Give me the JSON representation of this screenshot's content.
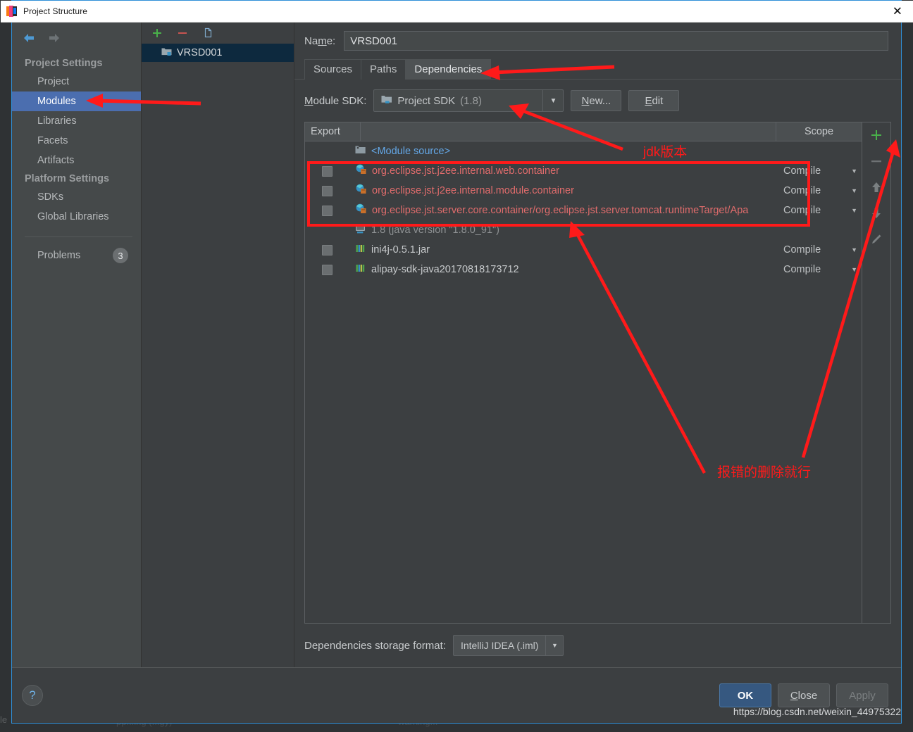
{
  "window": {
    "title": "Project Structure",
    "close_label": "✕"
  },
  "sidebar": {
    "back_icon": "back-arrow-icon",
    "forward_icon": "forward-arrow-icon",
    "groups": [
      {
        "label": "Project Settings"
      },
      {
        "label": "Platform Settings"
      }
    ],
    "project_settings_items": [
      {
        "label": "Project",
        "selected": false
      },
      {
        "label": "Modules",
        "selected": true
      },
      {
        "label": "Libraries",
        "selected": false
      },
      {
        "label": "Facets",
        "selected": false
      },
      {
        "label": "Artifacts",
        "selected": false
      }
    ],
    "platform_settings_items": [
      {
        "label": "SDKs",
        "selected": false
      },
      {
        "label": "Global Libraries",
        "selected": false
      }
    ],
    "problems": {
      "label": "Problems",
      "count": "3"
    }
  },
  "module_list": {
    "add_icon": "plus-icon",
    "remove_icon": "minus-icon",
    "copy_icon": "copy-icon",
    "items": [
      {
        "name": "VRSD001",
        "selected": true
      }
    ]
  },
  "detail": {
    "name_label": "Name:",
    "name_value": "VRSD001",
    "tabs": [
      {
        "label": "Sources",
        "active": false
      },
      {
        "label": "Paths",
        "active": false
      },
      {
        "label": "Dependencies",
        "active": true
      }
    ],
    "module_sdk": {
      "label": "Module SDK:",
      "value_main": "Project SDK",
      "value_sub": "(1.8)",
      "new_button": "New...",
      "edit_button": "Edit",
      "dropdown_icon": "chevron-down-icon"
    },
    "table": {
      "headers": {
        "export": "Export",
        "middle": "",
        "scope": "Scope"
      },
      "rows": [
        {
          "checkbox": false,
          "show_checkbox": false,
          "icon": "module-source-icon",
          "name": "<Module source>",
          "style": "link",
          "scope": "",
          "has_scope": false
        },
        {
          "checkbox": false,
          "show_checkbox": true,
          "icon": "library-error-icon",
          "name": "org.eclipse.jst.j2ee.internal.web.container",
          "style": "err",
          "scope": "Compile",
          "has_scope": true
        },
        {
          "checkbox": false,
          "show_checkbox": true,
          "icon": "library-error-icon",
          "name": "org.eclipse.jst.j2ee.internal.module.container",
          "style": "err",
          "scope": "Compile",
          "has_scope": true
        },
        {
          "checkbox": false,
          "show_checkbox": true,
          "icon": "library-error-icon",
          "name": "org.eclipse.jst.server.core.container/org.eclipse.jst.server.tomcat.runtimeTarget/Apa",
          "style": "err",
          "scope": "Compile",
          "has_scope": true
        },
        {
          "checkbox": false,
          "show_checkbox": false,
          "icon": "jdk-icon",
          "name": "1.8 (java version \"1.8.0_91\")",
          "style": "dim",
          "scope": "",
          "has_scope": false
        },
        {
          "checkbox": false,
          "show_checkbox": true,
          "icon": "jar-icon",
          "name": "ini4j-0.5.1.jar",
          "style": "normal",
          "scope": "Compile",
          "has_scope": true
        },
        {
          "checkbox": false,
          "show_checkbox": true,
          "icon": "jar-icon",
          "name": "alipay-sdk-java20170818173712",
          "style": "normal",
          "scope": "Compile",
          "has_scope": true
        }
      ],
      "side_buttons": [
        {
          "icon": "plus-icon",
          "name": "add-dependency-button"
        },
        {
          "icon": "minus-icon",
          "name": "remove-dependency-button"
        },
        {
          "icon": "arrow-up-icon",
          "name": "move-up-button"
        },
        {
          "icon": "arrow-down-icon",
          "name": "move-down-button"
        },
        {
          "icon": "pencil-icon",
          "name": "edit-dependency-button"
        }
      ]
    },
    "storage": {
      "label": "Dependencies storage format:",
      "value": "IntelliJ IDEA (.iml)",
      "dropdown_icon": "chevron-down-icon"
    }
  },
  "footer": {
    "help_icon": "?",
    "ok": "OK",
    "close": "Close",
    "apply": "Apply",
    "watermark": "https://blog.csdn.net/weixin_44975322"
  },
  "annotations": {
    "jdk_version": "jdk版本",
    "delete_errors": "报错的删除就行",
    "accent_color": "#ff1a1a"
  }
}
